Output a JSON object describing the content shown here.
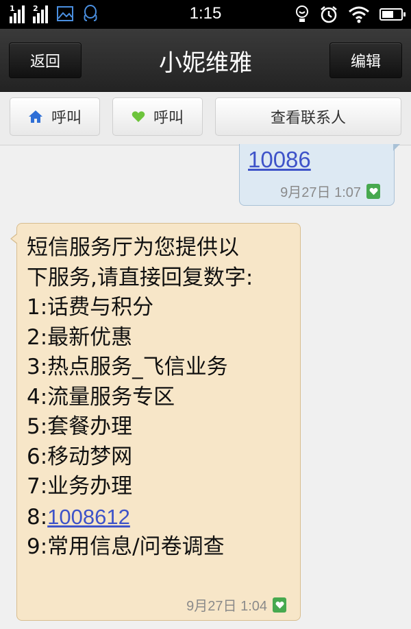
{
  "status_bar": {
    "sim1_label": "1",
    "sim2_label": "2",
    "time": "1:15",
    "icons": [
      "signal-icon",
      "signal-icon",
      "image-icon",
      "qq-icon",
      "lamp-icon",
      "alarm-icon",
      "wifi-icon",
      "battery-icon"
    ]
  },
  "title_bar": {
    "back_label": "返回",
    "title": "小妮维雅",
    "edit_label": "编辑"
  },
  "action_bar": {
    "call_home_label": "呼叫",
    "call_heart_label": "呼叫",
    "view_contact_label": "查看联系人"
  },
  "messages": {
    "outgoing": {
      "text": "10086",
      "time": "9月27日 1:07"
    },
    "incoming": {
      "lines": [
        "短信服务厅为您提供以",
        "下服务,请直接回复数字:",
        "1:话费与积分",
        "2:最新优惠",
        "3:热点服务_飞信业务",
        "4:流量服务专区",
        "5:套餐办理",
        "6:移动梦网",
        "7:业务办理"
      ],
      "line8_prefix": "8:",
      "line8_link": "1008612",
      "line9": "9:常用信息/问卷调查",
      "time": "9月27日 1:04"
    }
  },
  "colors": {
    "incoming_bubble": "#f7e6c8",
    "outgoing_bubble": "#dde9f3",
    "link": "#3e53c9",
    "heart_green": "#47a94f",
    "home_blue": "#2f6fd6"
  }
}
